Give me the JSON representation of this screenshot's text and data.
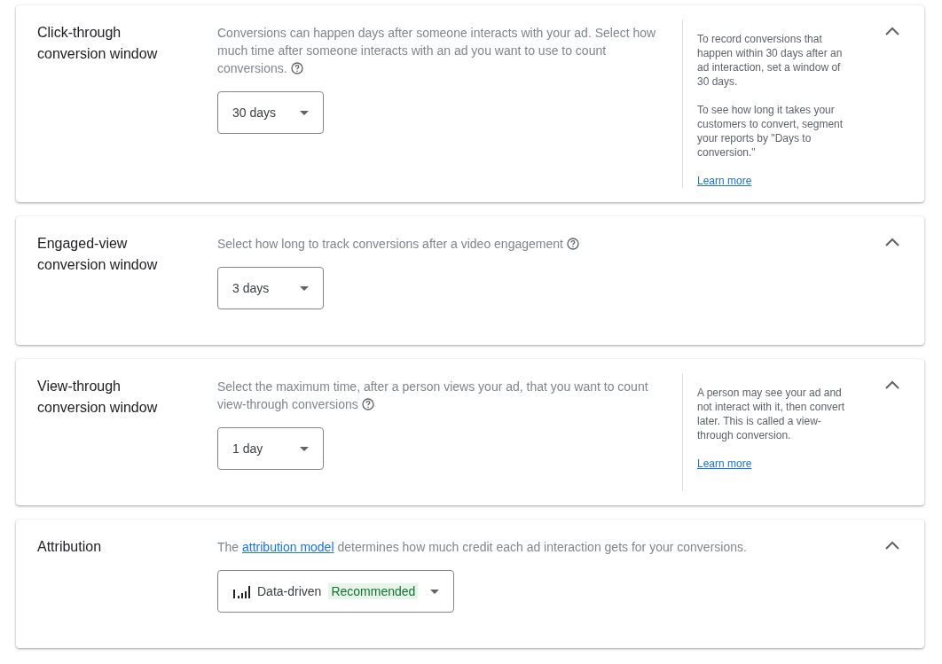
{
  "sections": [
    {
      "title": "Click-through conversion window",
      "expanded": true,
      "description": {
        "before": "Conversions can happen days after someone interacts with your ad. Select how much time after someone interacts with an ad you want to use to count conversions."
      },
      "help_icon": true,
      "dropdown": {
        "value": "30 days"
      },
      "side_note": {
        "paragraphs": [
          "To record conversions that happen within 30 days after an ad interaction, set a window of 30 days.",
          "To see how long it takes your customers to convert, segment your reports by \"Days to conversion.\""
        ],
        "link": "Learn more"
      }
    },
    {
      "title": "Engaged-view conversion window",
      "expanded": true,
      "description": {
        "before": "Select how long to track conversions after a video engagement"
      },
      "help_icon": true,
      "dropdown": {
        "value": "3 days"
      }
    },
    {
      "title": "View-through conversion window",
      "expanded": true,
      "description": {
        "before": "Select the maximum time, after a person views your ad, that you want to count view-through conversions"
      },
      "help_icon": true,
      "dropdown": {
        "value": "1 day"
      },
      "side_note": {
        "paragraphs": [
          "A person may see your ad and not interact with it, then convert later. This is called a view-through conversion."
        ],
        "link": "Learn more"
      }
    },
    {
      "title": "Attribution",
      "expanded": true,
      "description": {
        "before": "The",
        "link": "attribution model",
        "after": "determines how much credit each ad interaction gets for your conversions."
      },
      "dropdown": {
        "value": "Data-driven",
        "badge": "Recommended",
        "bars_icon": true
      }
    }
  ]
}
